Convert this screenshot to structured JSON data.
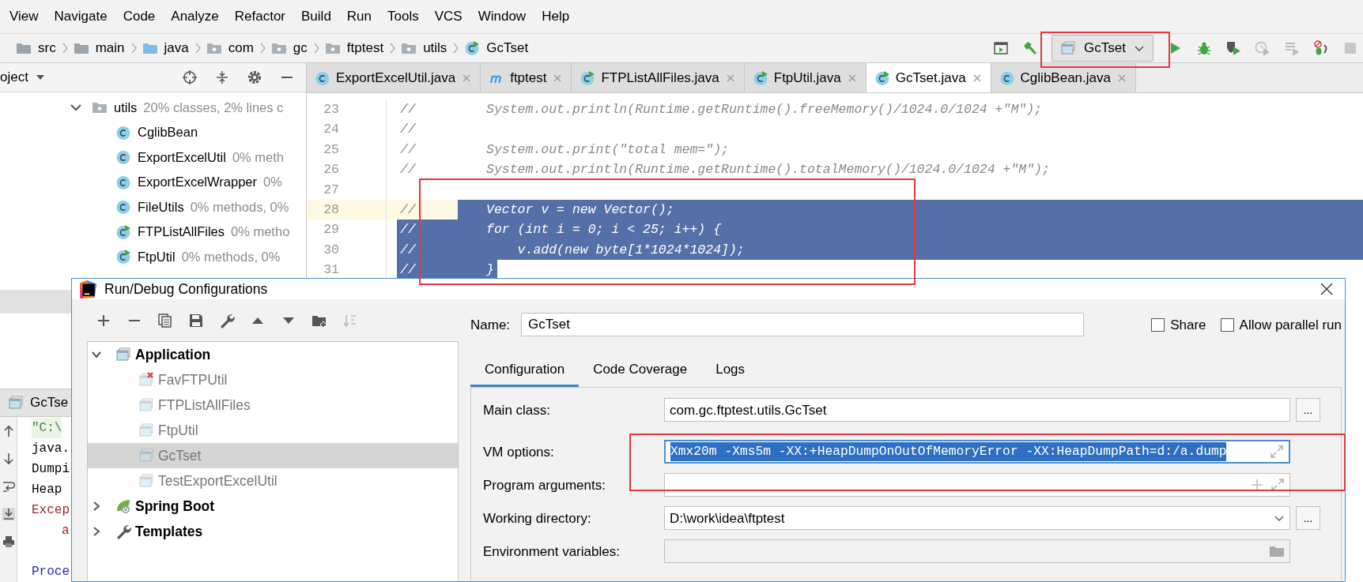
{
  "menu": [
    "View",
    "Navigate",
    "Code",
    "Analyze",
    "Refactor",
    "Build",
    "Run",
    "Tools",
    "VCS",
    "Window",
    "Help"
  ],
  "breadcrumbs": [
    {
      "label": "src",
      "kind": "folder"
    },
    {
      "label": "main",
      "kind": "folder"
    },
    {
      "label": "java",
      "kind": "source-folder"
    },
    {
      "label": "com",
      "kind": "package"
    },
    {
      "label": "gc",
      "kind": "package"
    },
    {
      "label": "ftptest",
      "kind": "package"
    },
    {
      "label": "utils",
      "kind": "package"
    },
    {
      "label": "GcTset",
      "kind": "class-run"
    }
  ],
  "run_configuration": "GcTset",
  "project_panel": {
    "title": "oject",
    "tree": [
      {
        "label": "utils",
        "kind": "package",
        "note": "20% classes, 2% lines c",
        "expanded": true,
        "children": [
          {
            "label": "CglibBean",
            "kind": "class"
          },
          {
            "label": "ExportExcelUtil",
            "kind": "class",
            "note": "0% meth"
          },
          {
            "label": "ExportExcelWrapper",
            "kind": "class",
            "note": "0%"
          },
          {
            "label": "FileUtils",
            "kind": "class",
            "note": "0% methods, 0%"
          },
          {
            "label": "FTPListAllFiles",
            "kind": "class-run",
            "note": "0% metho"
          },
          {
            "label": "FtpUtil",
            "kind": "class-run",
            "note": "0% methods, 0%"
          }
        ]
      }
    ]
  },
  "editor_tabs": [
    {
      "label": "ExportExcelUtil.java",
      "kind": "class",
      "selected": false
    },
    {
      "label": "ftptest",
      "kind": "module",
      "selected": false
    },
    {
      "label": "FTPListAllFiles.java",
      "kind": "class-run",
      "selected": false
    },
    {
      "label": "FtpUtil.java",
      "kind": "class-run",
      "selected": false
    },
    {
      "label": "GcTset.java",
      "kind": "class-run",
      "selected": true
    },
    {
      "label": "CglibBean.java",
      "kind": "class",
      "selected": false
    }
  ],
  "editor": {
    "lines": [
      {
        "number": "23",
        "comment": "//",
        "code": "System.out.println(Runtime.getRuntime().freeMemory()/1024.0/1024 +\"M\");",
        "current": false,
        "selected": false
      },
      {
        "number": "24",
        "comment": "//",
        "current": false,
        "selected": false
      },
      {
        "number": "25",
        "comment": "//",
        "code": "System.out.print(\"total mem=\");",
        "current": false,
        "selected": false
      },
      {
        "number": "26",
        "comment": "//",
        "code": "System.out.println(Runtime.getRuntime().totalMemory()/1024.0/1024 +\"M\");",
        "current": false,
        "selected": false
      },
      {
        "number": "27",
        "current": false,
        "selected": false
      },
      {
        "number": "28",
        "comment": "//",
        "code": "Vector v = new Vector();",
        "current": true,
        "selected": true
      },
      {
        "number": "29",
        "comment": "//",
        "code": "for (int i = 0; i < 25; i++) {",
        "current": false,
        "selected": true
      },
      {
        "number": "30",
        "comment": "//",
        "code": "    v.add(new byte[1*1024*1024]);",
        "current": false,
        "selected": true
      },
      {
        "number": "31",
        "comment": "//",
        "code": "}",
        "current": false,
        "selected": true
      }
    ]
  },
  "run_panel": {
    "title": "GcTse",
    "console": [
      {
        "text": "\"C:\\",
        "kind": "command"
      },
      {
        "text": "java.",
        "kind": "output"
      },
      {
        "text": "Dumpi",
        "kind": "output"
      },
      {
        "text": "Heap",
        "kind": "output"
      },
      {
        "text": "Excep",
        "kind": "error"
      },
      {
        "text": "a",
        "kind": "stack"
      },
      {
        "text": "Proce",
        "kind": "exit"
      }
    ]
  },
  "dialog": {
    "title": "Run/Debug Configurations",
    "tree": [
      {
        "label": "Application",
        "kind": "application",
        "expanded": true,
        "selected": false,
        "children": [
          {
            "label": "FavFTPUtil",
            "error": true,
            "selected": false
          },
          {
            "label": "FTPListAllFiles",
            "error": false,
            "selected": false
          },
          {
            "label": "FtpUtil",
            "error": false,
            "selected": false
          },
          {
            "label": "GcTset",
            "error": false,
            "selected": true
          },
          {
            "label": "TestExportExcelUtil",
            "error": false,
            "selected": false
          }
        ]
      },
      {
        "label": "Spring Boot",
        "kind": "spring",
        "expanded": false,
        "selected": false
      },
      {
        "label": "Templates",
        "kind": "wrench",
        "expanded": false,
        "selected": false
      }
    ],
    "name_label": "Name:",
    "name": "GcTset",
    "options": [
      {
        "label": "Share",
        "checked": false
      },
      {
        "label": "Allow parallel run",
        "checked": false
      }
    ],
    "tabs": [
      {
        "label": "Configuration",
        "selected": true
      },
      {
        "label": "Code Coverage",
        "selected": false
      },
      {
        "label": "Logs",
        "selected": false
      }
    ],
    "fields": [
      {
        "label": "Main class:",
        "value": "com.gc.ftptest.utils.GcTset",
        "kind": "browse",
        "button": "...",
        "text_selected": false
      },
      {
        "label": "VM options:",
        "value": "Xmx20m -Xms5m -XX:+HeapDumpOnOutOfMemoryError -XX:HeapDumpPath=d:/a.dump",
        "kind": "expand",
        "text_selected": true
      },
      {
        "label": "Program arguments:",
        "kind": "insert-expand",
        "text_selected": false
      },
      {
        "label": "Working directory:",
        "value": "D:\\work\\idea\\ftptest",
        "kind": "combo",
        "button": "...",
        "text_selected": false
      },
      {
        "label": "Environment variables:",
        "kind": "env",
        "text_selected": false
      }
    ]
  }
}
